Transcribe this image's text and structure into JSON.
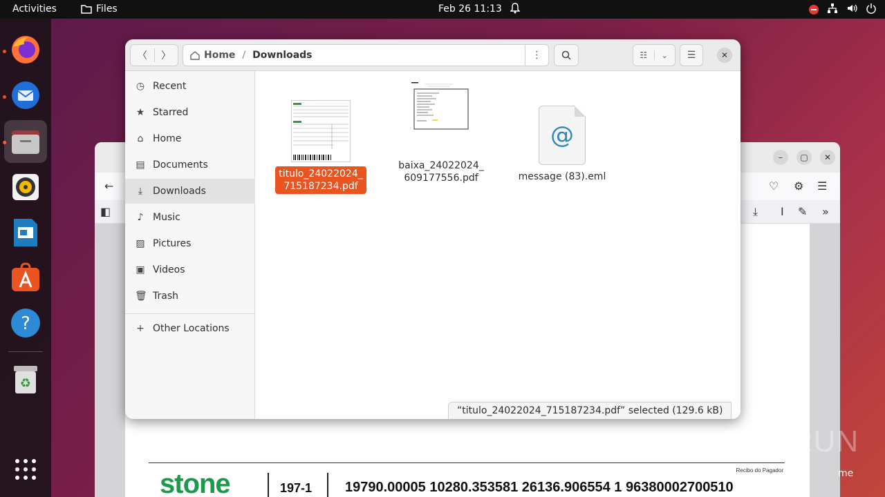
{
  "topbar": {
    "activities": "Activities",
    "app_name": "Files",
    "clock": "Feb 26  11:13"
  },
  "dock": {
    "items": [
      "firefox-icon",
      "thunderbird-icon",
      "files-icon",
      "rhythmbox-icon",
      "libreoffice-impress-icon",
      "app-center-icon",
      "help-icon",
      "trash-icon",
      "show-apps-icon"
    ]
  },
  "files": {
    "path": {
      "home": "Home",
      "current": "Downloads"
    },
    "sidebar": [
      {
        "label": "Recent",
        "icon": "clock-icon"
      },
      {
        "label": "Starred",
        "icon": "star-icon"
      },
      {
        "label": "Home",
        "icon": "home-icon"
      },
      {
        "label": "Documents",
        "icon": "document-icon"
      },
      {
        "label": "Downloads",
        "icon": "download-icon"
      },
      {
        "label": "Music",
        "icon": "music-icon"
      },
      {
        "label": "Pictures",
        "icon": "picture-icon"
      },
      {
        "label": "Videos",
        "icon": "video-icon"
      },
      {
        "label": "Trash",
        "icon": "trash-icon"
      },
      {
        "label": "Other Locations",
        "icon": "plus-icon"
      }
    ],
    "items": [
      {
        "line1": "titulo_24022024_",
        "line2": "715187234.pdf"
      },
      {
        "line1": "baixa_24022024_",
        "line2": "609177556.pdf"
      },
      {
        "line1": "message (83).eml",
        "line2": ""
      }
    ],
    "status": "“titulo_24022024_715187234.pdf” selected (129.6 kB)"
  },
  "browser_bg": {
    "logo": "stone",
    "bank_code": "197-1",
    "digitable_line": "19790.00005  10280.353581  26136.906554  1  96380002700510",
    "recibo": "Recibo do Pagador"
  },
  "watermark": "ANY RUN",
  "partial_text": "me"
}
